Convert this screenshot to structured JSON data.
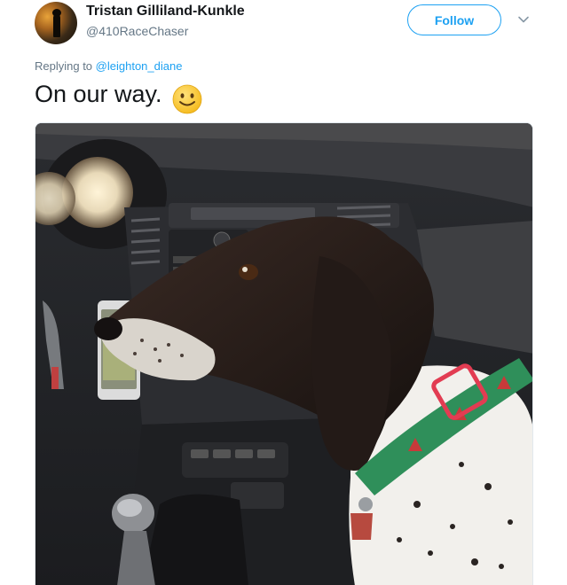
{
  "author": {
    "name": "Tristan Gilliland-Kunkle",
    "handle": "@410RaceChaser"
  },
  "follow_label": "Follow",
  "icons": {
    "menu": "chevron-down-icon",
    "emoji": "slightly-smiling-face-emoji"
  },
  "reply": {
    "prefix": "Replying to",
    "to": "@leighton_diane"
  },
  "tweet_text": "On our way.",
  "colors": {
    "accent": "#1da1f2",
    "secondary_text": "#657786",
    "primary_text": "#14171a"
  }
}
